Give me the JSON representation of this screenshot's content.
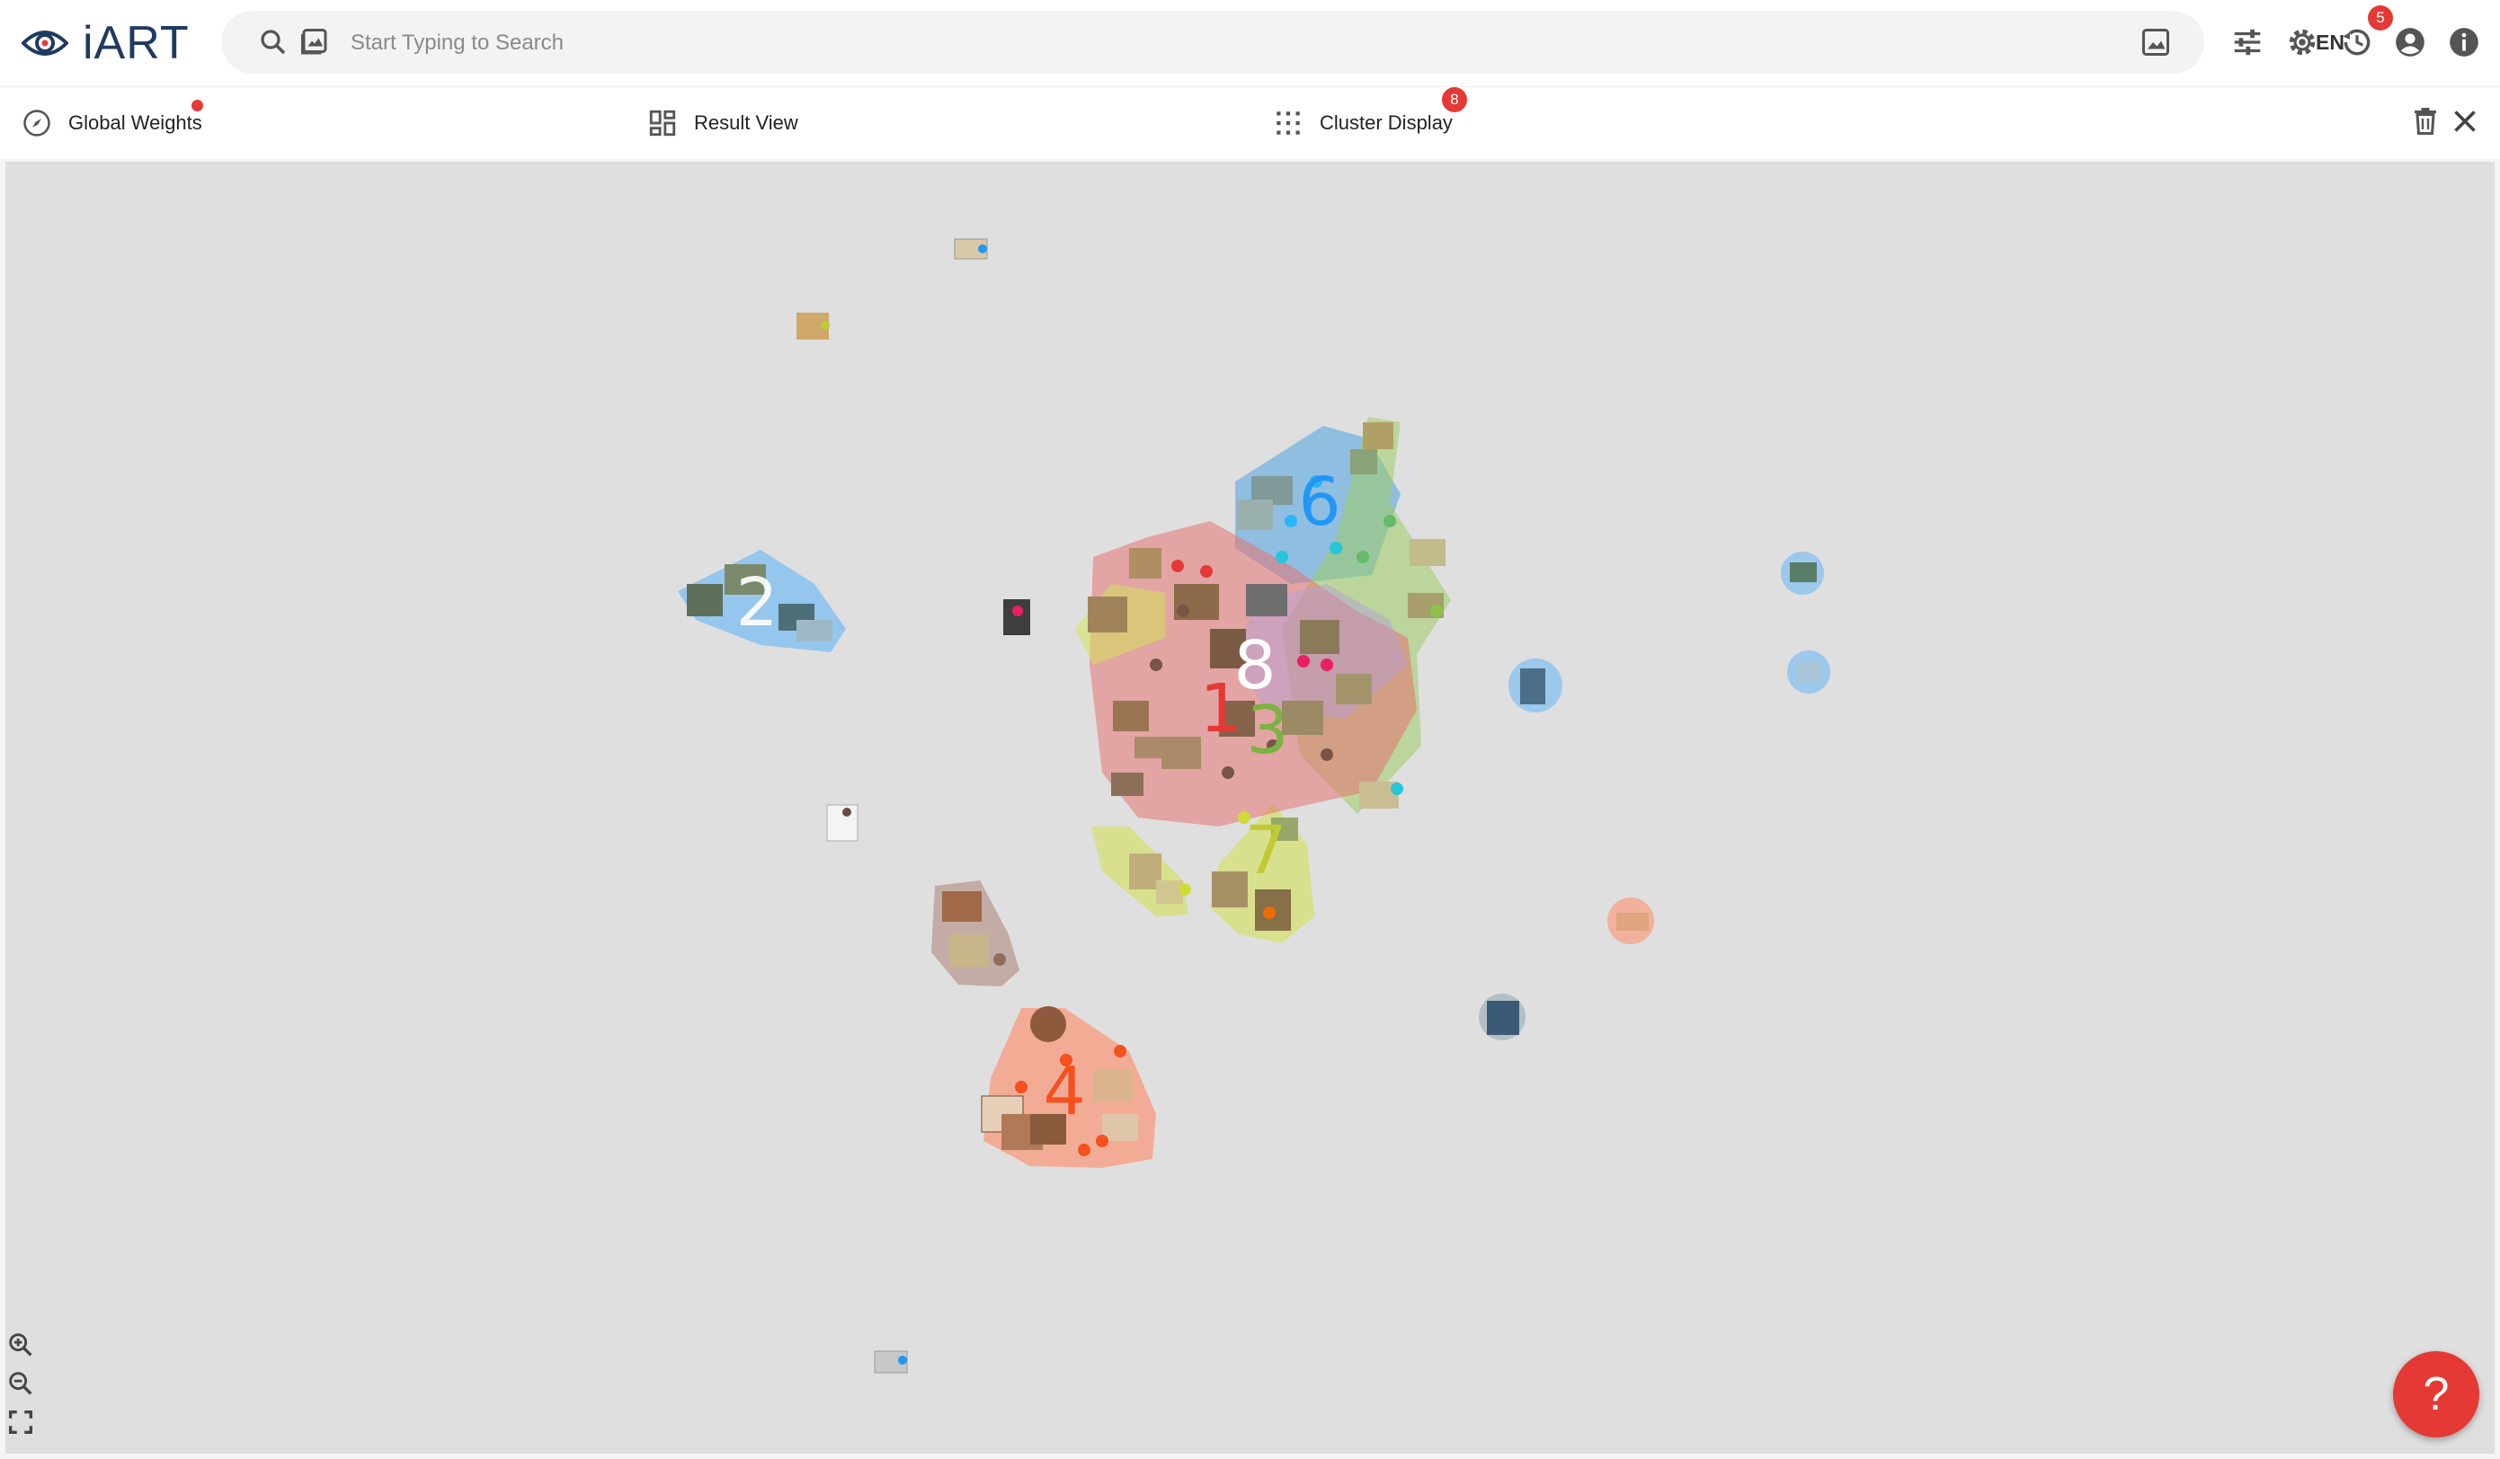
{
  "app": {
    "name": "iART"
  },
  "search": {
    "placeholder": "Start Typing to Search",
    "language": "EN"
  },
  "header": {
    "history_badge": "5"
  },
  "toolbar": {
    "global_weights_label": "Global Weights",
    "result_view_label": "Result View",
    "cluster_display_label": "Cluster Display",
    "cluster_badge": "8"
  },
  "clusters": [
    {
      "label": "1",
      "color": "#e53935"
    },
    {
      "label": "2",
      "color": "#2196f3"
    },
    {
      "label": "3",
      "color": "#7cb342"
    },
    {
      "label": "4",
      "color": "#f4511e"
    },
    {
      "label": "6",
      "color": "#1e88e5"
    },
    {
      "label": "7",
      "color": "#c0ca33"
    },
    {
      "label": "8",
      "color": "#ffffff"
    }
  ],
  "help": {
    "label": "?"
  },
  "colors": {
    "accent": "#e53935",
    "brand": "#1f3a5f",
    "map_bg": "#dfdfdf"
  },
  "icons": [
    "eye-logo-icon",
    "search-icon",
    "image-search-icon",
    "image-icon",
    "tune-icon",
    "gear-icon",
    "history-icon",
    "account-icon",
    "info-icon",
    "compass-icon",
    "dashboard-icon",
    "grid-dots-icon",
    "trash-icon",
    "close-icon",
    "zoom-in-icon",
    "zoom-out-icon",
    "fit-screen-icon"
  ]
}
